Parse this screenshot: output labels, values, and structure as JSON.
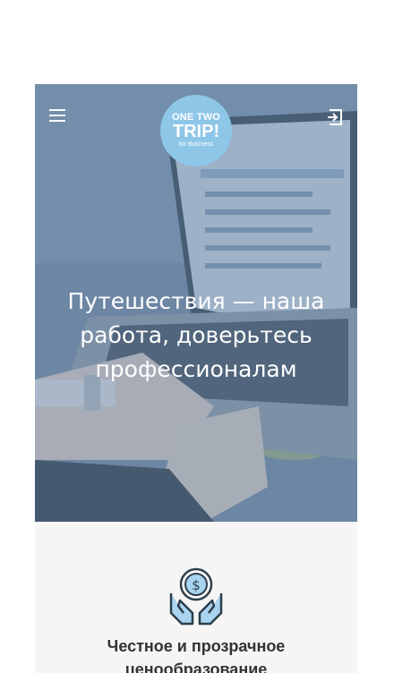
{
  "header": {
    "logo": {
      "line1": "ONE TWO",
      "line2": "TRIP!",
      "line3": "for Business"
    },
    "menu_icon": "hamburger-menu-icon",
    "login_icon": "login-icon"
  },
  "hero": {
    "title": "Путешествия — наша работа, доверьтесь профессионалам"
  },
  "feature": {
    "icon": "money-hands-icon",
    "title": "Честное и прозрачное ценообразование"
  },
  "colors": {
    "logo_bg": "#8ec6e8",
    "hero_tint": "#56789e",
    "section_bg": "#f5f5f5",
    "icon_fill": "#a8d4f0"
  }
}
